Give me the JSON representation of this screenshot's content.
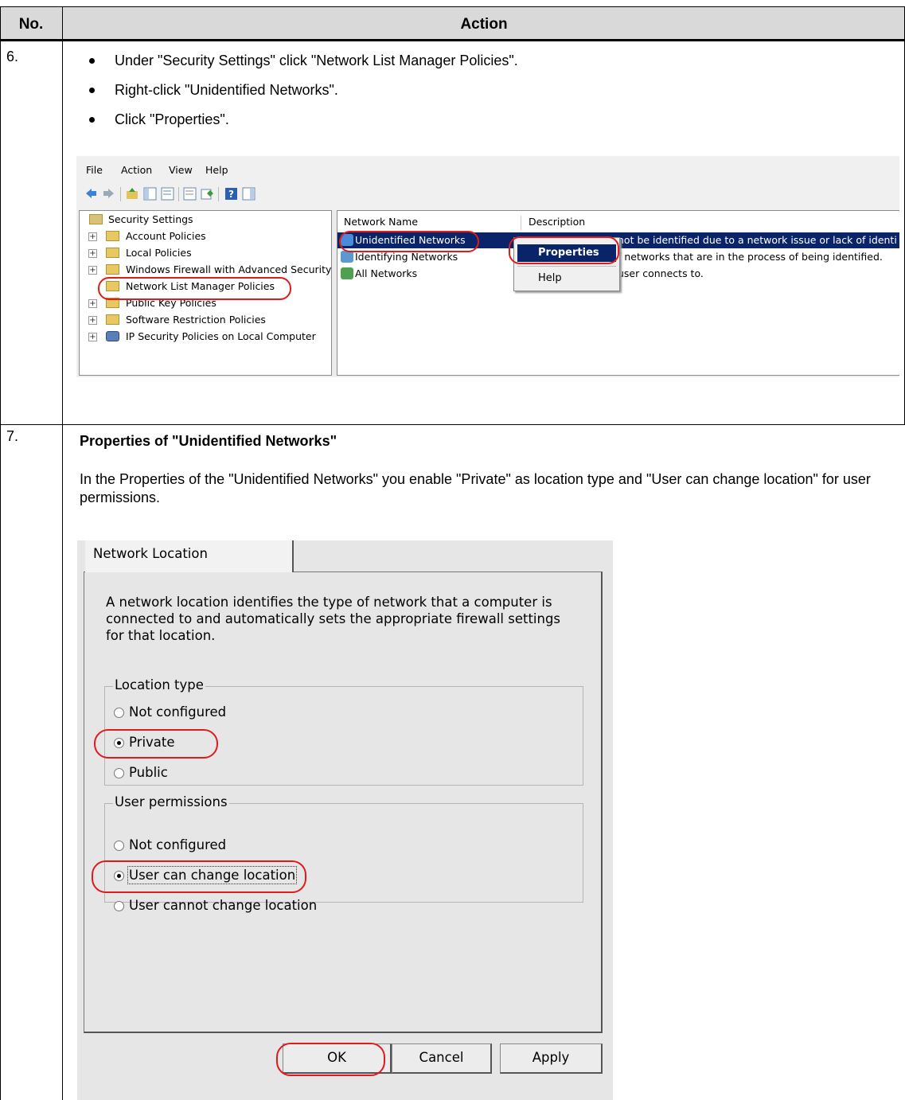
{
  "table": {
    "header_no": "No.",
    "header_action": "Action"
  },
  "step6": {
    "number": "6.",
    "bullets": [
      "Under \"Security Settings\" click \"Network List Manager Policies\".",
      "Right-click \"Unidentified Networks\".",
      "Click \"Properties\"."
    ]
  },
  "mmc": {
    "menu": [
      "File",
      "Action",
      "View",
      "Help"
    ],
    "tree": [
      "Security Settings",
      "Account Policies",
      "Local Policies",
      "Windows Firewall with Advanced Security",
      "Network List Manager Policies",
      "Public Key Policies",
      "Software Restriction Policies",
      "IP Security Policies on Local Computer"
    ],
    "columns": [
      "Network Name",
      "Description"
    ],
    "rows": [
      {
        "name": "Unidentified Networks",
        "desc": "not be identified due to a network issue or lack of identi"
      },
      {
        "name": "Identifying Networks",
        "desc": "f networks that are in the process of being identified."
      },
      {
        "name": "All Networks",
        "desc": "user connects to."
      }
    ],
    "context_menu": [
      "Properties",
      "Help"
    ],
    "colors": {
      "selection": "#0a246a",
      "highlight_oval": "#e01b1b"
    }
  },
  "step7": {
    "number": "7.",
    "title": "Properties of \"Unidentified Networks\"",
    "description": "In the Properties of the \"Unidentified Networks\" you enable \"Private\" as location type and \"User can change location\" for user permissions."
  },
  "dialog": {
    "tab": "Network Location",
    "text": "A network location identifies the type of network that a computer is connected to and automatically sets the appropriate firewall settings for that location.",
    "location_type": {
      "legend": "Location type",
      "options": [
        "Not configured",
        "Private",
        "Public"
      ],
      "selected": "Private"
    },
    "user_permissions": {
      "legend": "User permissions",
      "options": [
        "Not configured",
        "User can change location",
        "User cannot change location"
      ],
      "selected": "User can change location"
    },
    "buttons": {
      "ok": "OK",
      "cancel": "Cancel",
      "apply": "Apply"
    }
  }
}
